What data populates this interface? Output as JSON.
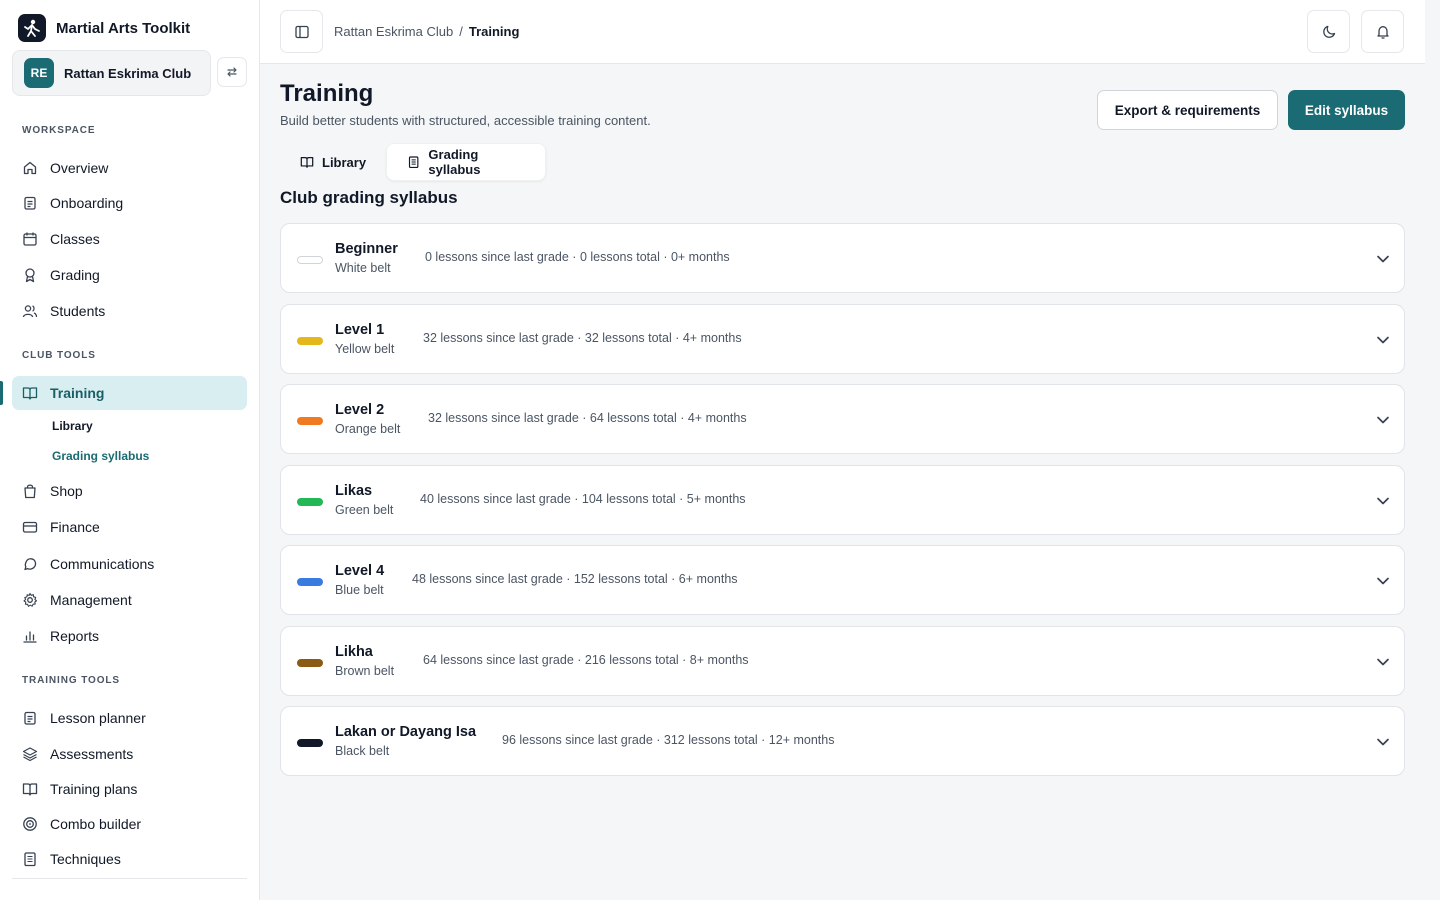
{
  "app": {
    "name": "Martial Arts Toolkit"
  },
  "club": {
    "initials": "RE",
    "name": "Rattan Eskrima Club"
  },
  "sidebar": {
    "workspace_title": "WORKSPACE",
    "workspace": [
      {
        "label": "Overview",
        "icon": "home-icon"
      },
      {
        "label": "Onboarding",
        "icon": "clipboard-icon"
      },
      {
        "label": "Classes",
        "icon": "calendar-icon"
      },
      {
        "label": "Grading",
        "icon": "award-icon"
      },
      {
        "label": "Students",
        "icon": "users-icon"
      }
    ],
    "club_tools_title": "CLUB TOOLS",
    "club_tools": [
      {
        "label": "Training",
        "icon": "book-open-icon",
        "active": true
      },
      {
        "label": "Shop",
        "icon": "shopping-bag-icon"
      },
      {
        "label": "Finance",
        "icon": "credit-card-icon"
      },
      {
        "label": "Communications",
        "icon": "message-circle-icon"
      },
      {
        "label": "Management",
        "icon": "settings-icon"
      },
      {
        "label": "Reports",
        "icon": "bar-chart-icon"
      }
    ],
    "training_sub": [
      {
        "label": "Library",
        "active": false
      },
      {
        "label": "Grading syllabus",
        "active": true
      }
    ],
    "training_tools_title": "TRAINING TOOLS",
    "training_tools": [
      {
        "label": "Lesson planner",
        "icon": "clipboard-list-icon"
      },
      {
        "label": "Assessments",
        "icon": "layers-icon"
      },
      {
        "label": "Training plans",
        "icon": "book-icon"
      },
      {
        "label": "Combo builder",
        "icon": "target-icon"
      },
      {
        "label": "Techniques",
        "icon": "file-text-icon"
      }
    ]
  },
  "topbar": {
    "breadcrumb_parent": "Rattan Eskrima Club",
    "breadcrumb_sep": "/",
    "breadcrumb_current": "Training"
  },
  "header": {
    "title": "Training",
    "subtitle": "Build better students with structured, accessible training content.",
    "export_label": "Export & requirements",
    "edit_label": "Edit syllabus"
  },
  "tabs": [
    {
      "label": "Library",
      "active": false
    },
    {
      "label": "Grading syllabus",
      "active": true
    }
  ],
  "syllabus": {
    "heading": "Club grading syllabus",
    "grades": [
      {
        "name": "Beginner",
        "belt": "White belt",
        "meta": "0 lessons since last grade · 0 lessons total · 0+ months",
        "color": "#ffffff"
      },
      {
        "name": "Level 1",
        "belt": "Yellow belt",
        "meta": "32 lessons since last grade · 32 lessons total · 4+ months",
        "color": "#e4b81c"
      },
      {
        "name": "Level 2",
        "belt": "Orange belt",
        "meta": "32 lessons since last grade · 64 lessons total · 4+ months",
        "color": "#f07a22"
      },
      {
        "name": "Likas",
        "belt": "Green belt",
        "meta": "40 lessons since last grade · 104 lessons total · 5+ months",
        "color": "#22b855"
      },
      {
        "name": "Level 4",
        "belt": "Blue belt",
        "meta": "48 lessons since last grade · 152 lessons total · 6+ months",
        "color": "#3a7be0"
      },
      {
        "name": "Likha",
        "belt": "Brown belt",
        "meta": "64 lessons since last grade · 216 lessons total · 8+ months",
        "color": "#8b5a14"
      },
      {
        "name": "Lakan or Dayang Isa",
        "belt": "Black belt",
        "meta": "96 lessons since last grade · 312 lessons total · 12+ months",
        "color": "#111827"
      }
    ]
  }
}
